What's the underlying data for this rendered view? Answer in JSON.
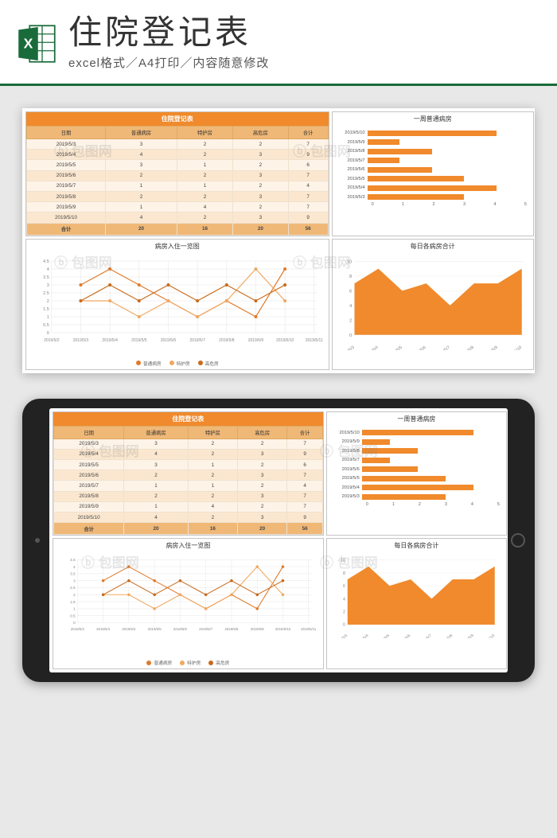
{
  "header": {
    "title": "住院登记表",
    "subtitle": "excel格式／A4打印／内容随意修改"
  },
  "table": {
    "title": "住院登记表",
    "columns": [
      "日期",
      "普通病房",
      "特护房",
      "高危房",
      "合计"
    ],
    "rows": [
      [
        "2019/5/3",
        "3",
        "2",
        "2",
        "7"
      ],
      [
        "2019/5/4",
        "4",
        "2",
        "3",
        "9"
      ],
      [
        "2019/5/5",
        "3",
        "1",
        "2",
        "6"
      ],
      [
        "2019/5/6",
        "2",
        "2",
        "3",
        "7"
      ],
      [
        "2019/5/7",
        "1",
        "1",
        "2",
        "4"
      ],
      [
        "2019/5/8",
        "2",
        "2",
        "3",
        "7"
      ],
      [
        "2019/5/9",
        "1",
        "4",
        "2",
        "7"
      ],
      [
        "2019/5/10",
        "4",
        "2",
        "3",
        "9"
      ]
    ],
    "totals": [
      "合计",
      "20",
      "16",
      "20",
      "56"
    ]
  },
  "bar_chart": {
    "title": "一周普通病房",
    "max": 5,
    "ticks": [
      "0",
      "1",
      "2",
      "3",
      "4",
      "5"
    ],
    "items": [
      {
        "label": "2019/5/10",
        "value": 4
      },
      {
        "label": "2019/5/9",
        "value": 1
      },
      {
        "label": "2019/5/8",
        "value": 2
      },
      {
        "label": "2019/5/7",
        "value": 1
      },
      {
        "label": "2019/5/6",
        "value": 2
      },
      {
        "label": "2019/5/5",
        "value": 3
      },
      {
        "label": "2019/5/4",
        "value": 4
      },
      {
        "label": "2019/5/3",
        "value": 3
      }
    ]
  },
  "line_chart": {
    "title": "病房入住一览图",
    "x": [
      "2019/5/2",
      "2019/5/3",
      "2019/5/4",
      "2019/5/5",
      "2019/5/6",
      "2019/5/7",
      "2019/5/8",
      "2019/5/9",
      "2019/5/10",
      "2019/5/11"
    ],
    "y_ticks": [
      "0",
      "0.5",
      "1",
      "1.5",
      "2",
      "2.5",
      "3",
      "3.5",
      "4",
      "4.5"
    ],
    "ymax": 4.5,
    "series": [
      {
        "name": "普通病房",
        "color": "#e07a2a",
        "values": [
          3,
          4,
          3,
          2,
          1,
          2,
          1,
          4
        ]
      },
      {
        "name": "特护房",
        "color": "#f0a860",
        "values": [
          2,
          2,
          1,
          2,
          1,
          2,
          4,
          2
        ]
      },
      {
        "name": "高危房",
        "color": "#c96a1a",
        "values": [
          2,
          3,
          2,
          3,
          2,
          3,
          2,
          3
        ]
      }
    ]
  },
  "area_chart": {
    "title": "每日各病房合计",
    "x": [
      "2019/5/3",
      "2019/5/4",
      "2019/5/5",
      "2019/5/6",
      "2019/5/7",
      "2019/5/8",
      "2019/5/9",
      "2019/5/10"
    ],
    "y_ticks": [
      "0",
      "2",
      "4",
      "6",
      "8",
      "10"
    ],
    "ymax": 10,
    "values": [
      7,
      9,
      6,
      7,
      4,
      7,
      7,
      9
    ],
    "color": "#f08a2c"
  },
  "watermark": "包图网",
  "chart_data": [
    {
      "type": "table",
      "title": "住院登记表",
      "columns": [
        "日期",
        "普通病房",
        "特护房",
        "高危房",
        "合计"
      ],
      "rows": [
        [
          "2019/5/3",
          3,
          2,
          2,
          7
        ],
        [
          "2019/5/4",
          4,
          2,
          3,
          9
        ],
        [
          "2019/5/5",
          3,
          1,
          2,
          6
        ],
        [
          "2019/5/6",
          2,
          2,
          3,
          7
        ],
        [
          "2019/5/7",
          1,
          1,
          2,
          4
        ],
        [
          "2019/5/8",
          2,
          2,
          3,
          7
        ],
        [
          "2019/5/9",
          1,
          4,
          2,
          7
        ],
        [
          "2019/5/10",
          4,
          2,
          3,
          9
        ]
      ],
      "totals": [
        "合计",
        20,
        16,
        20,
        56
      ]
    },
    {
      "type": "bar",
      "title": "一周普通病房",
      "orientation": "horizontal",
      "categories": [
        "2019/5/3",
        "2019/5/4",
        "2019/5/5",
        "2019/5/6",
        "2019/5/7",
        "2019/5/8",
        "2019/5/9",
        "2019/5/10"
      ],
      "values": [
        3,
        4,
        3,
        2,
        1,
        2,
        1,
        4
      ],
      "xlim": [
        0,
        5
      ]
    },
    {
      "type": "line",
      "title": "病房入住一览图",
      "categories": [
        "2019/5/3",
        "2019/5/4",
        "2019/5/5",
        "2019/5/6",
        "2019/5/7",
        "2019/5/8",
        "2019/5/9",
        "2019/5/10"
      ],
      "series": [
        {
          "name": "普通病房",
          "values": [
            3,
            4,
            3,
            2,
            1,
            2,
            1,
            4
          ]
        },
        {
          "name": "特护房",
          "values": [
            2,
            2,
            1,
            2,
            1,
            2,
            4,
            2
          ]
        },
        {
          "name": "高危房",
          "values": [
            2,
            3,
            2,
            3,
            2,
            3,
            2,
            3
          ]
        }
      ],
      "ylim": [
        0,
        4.5
      ]
    },
    {
      "type": "area",
      "title": "每日各病房合计",
      "categories": [
        "2019/5/3",
        "2019/5/4",
        "2019/5/5",
        "2019/5/6",
        "2019/5/7",
        "2019/5/8",
        "2019/5/9",
        "2019/5/10"
      ],
      "values": [
        7,
        9,
        6,
        7,
        4,
        7,
        7,
        9
      ],
      "ylim": [
        0,
        10
      ]
    }
  ]
}
